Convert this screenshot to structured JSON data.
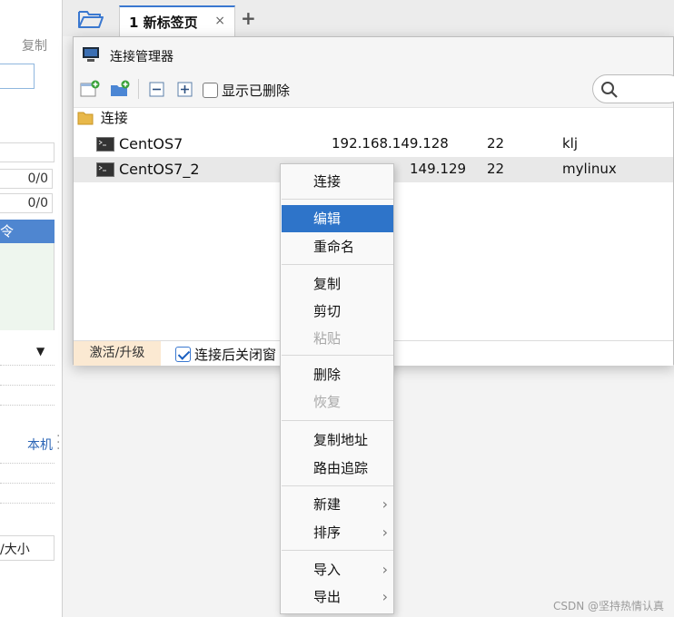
{
  "left_panel": {
    "copy_label": "复制",
    "value_1": "0/0",
    "value_2": "0/0",
    "selected_item": "令",
    "local_label": "本机",
    "size_label": "/大小"
  },
  "tabs": {
    "active_tab": "1 新标签页",
    "close_glyph": "×",
    "add_glyph": "+"
  },
  "connection_manager": {
    "title": "连接管理器",
    "show_deleted_label": "显示已删除",
    "show_deleted_checked": false,
    "search_placeholder": "",
    "tree_root": "连接",
    "connections": [
      {
        "name": "CentOS7",
        "host": "192.168.149.128",
        "port": "22",
        "user": "klj"
      },
      {
        "name": "CentOS7_2",
        "host": "192.168.149.129",
        "host_visible": "149.129",
        "port": "22",
        "user": "mylinux"
      }
    ],
    "footer": {
      "activate_label": "激活/升级",
      "close_after_connect_label": "连接后关闭窗",
      "close_after_connect_checked": true
    }
  },
  "context_menu": {
    "items": [
      {
        "label": "连接",
        "state": "normal"
      },
      {
        "label": "编辑",
        "state": "highlighted"
      },
      {
        "label": "重命名",
        "state": "normal"
      },
      {
        "label": "复制",
        "state": "normal"
      },
      {
        "label": "剪切",
        "state": "normal"
      },
      {
        "label": "粘贴",
        "state": "disabled"
      },
      {
        "label": "删除",
        "state": "normal"
      },
      {
        "label": "恢复",
        "state": "disabled"
      },
      {
        "label": "复制地址",
        "state": "normal"
      },
      {
        "label": "路由追踪",
        "state": "normal"
      },
      {
        "label": "新建",
        "state": "submenu"
      },
      {
        "label": "排序",
        "state": "submenu"
      },
      {
        "label": "导入",
        "state": "submenu"
      },
      {
        "label": "导出",
        "state": "submenu"
      }
    ],
    "submenu_glyph": "›"
  },
  "watermark": "CSDN @坚持热情认真",
  "colors": {
    "highlight": "#2e74c9",
    "selected_row": "#e8e8e8",
    "activate_bg": "#fbe9d2",
    "tab_accent": "#3a78d0"
  }
}
